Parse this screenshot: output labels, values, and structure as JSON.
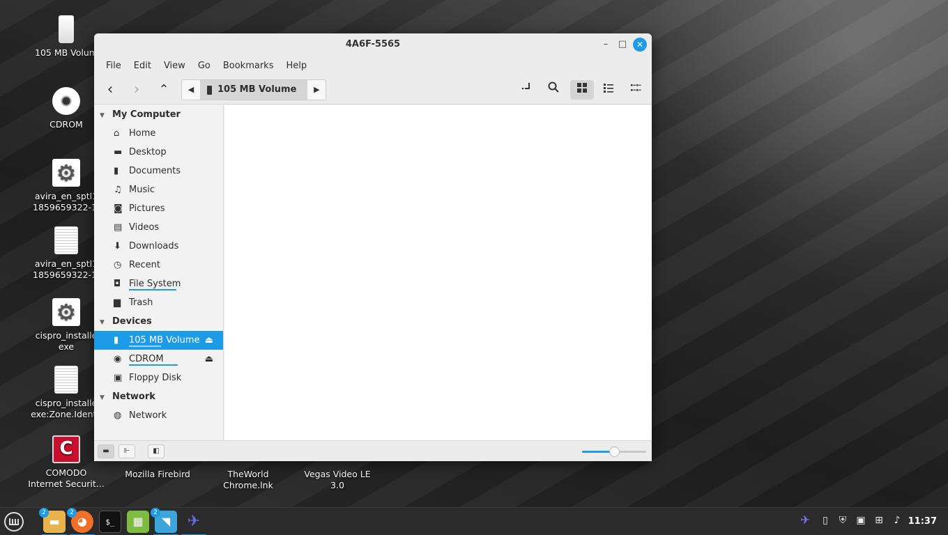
{
  "desktop": {
    "icons": [
      {
        "label": "105 MB Volum"
      },
      {
        "label": "CDROM"
      },
      {
        "label": "avira_en_sptl1 1859659322-1."
      },
      {
        "label": "avira_en_sptl1 1859659322-1."
      },
      {
        "label": "cispro_installe exe"
      },
      {
        "label": "cispro_installe exe:Zone.Identi."
      },
      {
        "label": "COMODO Internet Securit..."
      },
      {
        "label": "Mozilla Firebird"
      },
      {
        "label": "TheWorld Chrome.lnk"
      },
      {
        "label": "Vegas Video LE 3.0"
      }
    ]
  },
  "window": {
    "title": "4A6F-5565",
    "controls": {
      "minimize": "–",
      "maximize": "□",
      "close": "✕"
    }
  },
  "menubar": {
    "items": [
      "File",
      "Edit",
      "View",
      "Go",
      "Bookmarks",
      "Help"
    ]
  },
  "toolbar": {
    "back": "‹",
    "forward": "›",
    "up": "⌃",
    "path_prev": "◀",
    "path_next": "▶",
    "path_segment": "105 MB Volume",
    "icons": [
      "toggle-location-icon",
      "search-icon",
      "icon-view-icon",
      "list-view-icon",
      "compact-view-icon"
    ],
    "view_mode": "icon-view"
  },
  "sidebar": {
    "sections": [
      {
        "title": "My Computer",
        "items": [
          {
            "label": "Home",
            "icon": "home-icon"
          },
          {
            "label": "Desktop",
            "icon": "desktop-icon"
          },
          {
            "label": "Documents",
            "icon": "documents-icon"
          },
          {
            "label": "Music",
            "icon": "music-icon"
          },
          {
            "label": "Pictures",
            "icon": "pictures-icon"
          },
          {
            "label": "Videos",
            "icon": "videos-icon"
          },
          {
            "label": "Downloads",
            "icon": "downloads-icon"
          },
          {
            "label": "Recent",
            "icon": "recent-icon"
          },
          {
            "label": "File System",
            "icon": "filesystem-icon"
          },
          {
            "label": "Trash",
            "icon": "trash-icon"
          }
        ]
      },
      {
        "title": "Devices",
        "items": [
          {
            "label": "105 MB Volume",
            "icon": "usb-drive-icon",
            "selected": true
          },
          {
            "label": "CDROM",
            "icon": "cdrom-icon"
          },
          {
            "label": "Floppy Disk",
            "icon": "floppy-icon"
          }
        ]
      },
      {
        "title": "Network",
        "items": [
          {
            "label": "Network",
            "icon": "network-icon"
          }
        ]
      }
    ],
    "eject_glyph": "⏏"
  },
  "statusbar": {
    "zoom_level_fraction": 0.5
  },
  "taskbar": {
    "apps": [
      {
        "name": "mint-menu-icon"
      },
      {
        "name": "files-icon",
        "badge": "2"
      },
      {
        "name": "firefox-icon",
        "badge": "2"
      },
      {
        "name": "terminal-icon"
      },
      {
        "name": "calculator-icon"
      },
      {
        "name": "dolphin-icon",
        "badge": "2"
      },
      {
        "name": "bird-app-icon"
      }
    ],
    "terminal_text": "$_",
    "clock": "11:37"
  },
  "colors": {
    "accent": "#1e9be6",
    "window_bg": "#f2f2f2",
    "taskbar_bg": "#2b2b2b"
  }
}
